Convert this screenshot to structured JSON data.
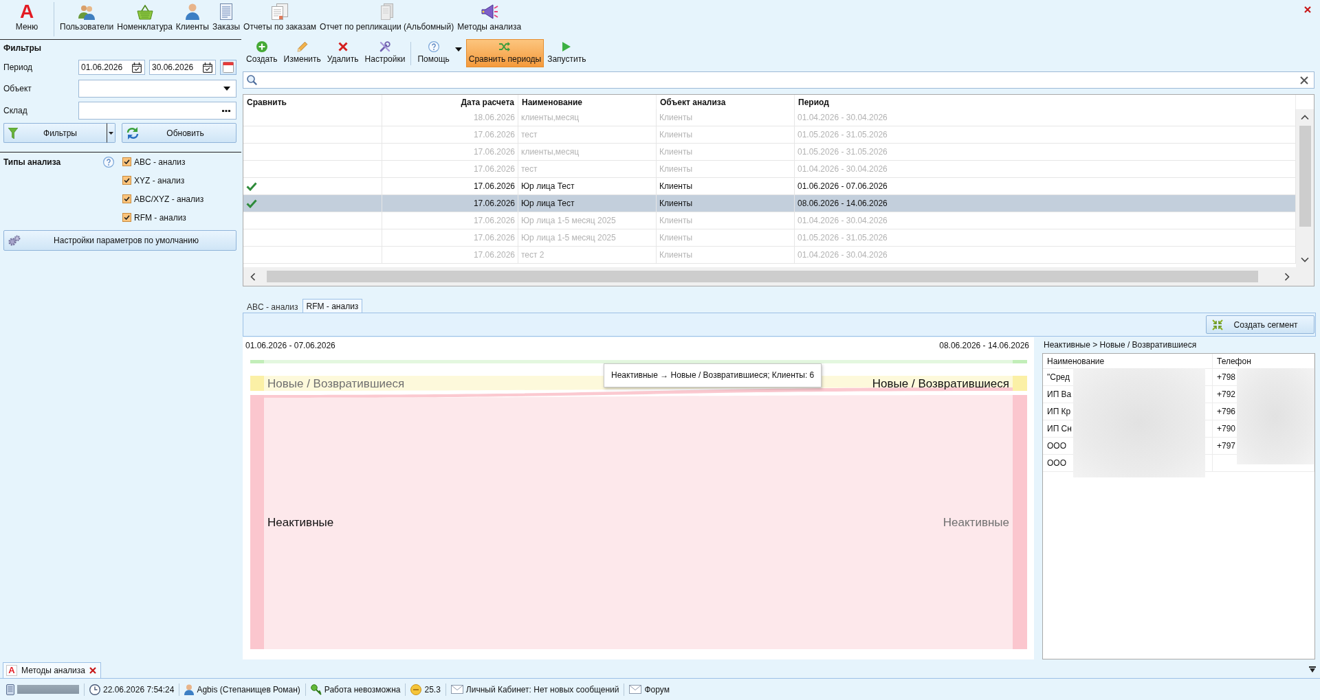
{
  "window": {
    "logo": "A",
    "menu_label": "Меню"
  },
  "ribbon": [
    {
      "label": "Пользователи"
    },
    {
      "label": "Номенклатура"
    },
    {
      "label": "Клиенты"
    },
    {
      "label": "Заказы"
    },
    {
      "label": "Отчеты по заказам"
    },
    {
      "label": "Отчет по репликации (Альбомный)"
    },
    {
      "label": "Методы анализа"
    }
  ],
  "filters": {
    "title": "Фильтры",
    "period_label": "Период",
    "date_from": "01.06.2026",
    "date_to": "30.06.2026",
    "object_label": "Объект",
    "warehouse_label": "Склад",
    "filters_button": "Фильтры",
    "refresh_button": "Обновить"
  },
  "analysis_types": {
    "title": "Типы анализа",
    "items": [
      {
        "label": "ABC - анализ",
        "checked": true
      },
      {
        "label": "XYZ - анализ",
        "checked": true
      },
      {
        "label": "ABC/XYZ - анализ",
        "checked": true
      },
      {
        "label": "RFM - анализ",
        "checked": true
      }
    ]
  },
  "defaults_button": "Настройки параметров по умолчанию",
  "toolbar": {
    "groups": [
      [
        {
          "label": "Создать",
          "kind": "button",
          "selected": false
        },
        {
          "label": "Изменить",
          "kind": "button",
          "selected": false
        },
        {
          "label": "Удалить",
          "kind": "button",
          "selected": false
        },
        {
          "label": "Настройки",
          "kind": "button",
          "selected": false
        }
      ],
      [
        {
          "label": "Помощь",
          "kind": "dropdown",
          "selected": false
        },
        {
          "label": "Сравнить периоды",
          "kind": "button",
          "selected": true
        },
        {
          "label": "Запустить",
          "kind": "button",
          "selected": false
        }
      ]
    ]
  },
  "table": {
    "columns": [
      "Сравнить",
      "Дата расчета",
      "Наименование",
      "Объект анализа",
      "Период"
    ],
    "rows": [
      {
        "compared": false,
        "selected": false,
        "disabled": true,
        "date": "18.06.2026",
        "name": "клиенты,месяц",
        "object": "Клиенты",
        "period": "01.04.2026 - 30.04.2026"
      },
      {
        "compared": false,
        "selected": false,
        "disabled": true,
        "date": "17.06.2026",
        "name": "тест",
        "object": "Клиенты",
        "period": "01.05.2026 - 31.05.2026"
      },
      {
        "compared": false,
        "selected": false,
        "disabled": true,
        "date": "17.06.2026",
        "name": "клиенты,месяц",
        "object": "Клиенты",
        "period": "01.05.2026 - 31.05.2026"
      },
      {
        "compared": false,
        "selected": false,
        "disabled": true,
        "date": "17.06.2026",
        "name": "тест",
        "object": "Клиенты",
        "period": "01.04.2026 - 30.04.2026"
      },
      {
        "compared": true,
        "selected": false,
        "disabled": false,
        "date": "17.06.2026",
        "name": "Юр лица Тест",
        "object": "Клиенты",
        "period": "01.06.2026 - 07.06.2026"
      },
      {
        "compared": true,
        "selected": true,
        "disabled": false,
        "date": "17.06.2026",
        "name": "Юр лица Тест",
        "object": "Клиенты",
        "period": "08.06.2026 - 14.06.2026"
      },
      {
        "compared": false,
        "selected": false,
        "disabled": true,
        "date": "17.06.2026",
        "name": "Юр лица 1-5 месяц 2025",
        "object": "Клиенты",
        "period": "01.04.2026 - 30.04.2026"
      },
      {
        "compared": false,
        "selected": false,
        "disabled": true,
        "date": "17.06.2026",
        "name": "Юр лица 1-5 месяц 2025",
        "object": "Клиенты",
        "period": "01.05.2026 - 31.05.2026"
      },
      {
        "compared": false,
        "selected": false,
        "disabled": true,
        "date": "17.06.2026",
        "name": "тест 2",
        "object": "Клиенты",
        "period": "01.04.2026 - 30.04.2026"
      }
    ]
  },
  "analysis_tabs": [
    {
      "label": "ABC - анализ",
      "selected": false
    },
    {
      "label": "RFM - анализ",
      "selected": true
    }
  ],
  "create_segment_button": "Создать сегмент",
  "sankey": {
    "left_period": "01.06.2026 - 07.06.2026",
    "right_period": "08.06.2026 - 14.06.2026",
    "left_nodes": [
      {
        "color": "#c2eeb8"
      },
      {
        "color": "#fbf0a6",
        "label": {
          "text": "Новые / Возвратившиеся",
          "highlighted": false
        }
      },
      {
        "color": "#fbc6ce",
        "label": {
          "text": "Неактивные",
          "highlighted": true
        }
      }
    ],
    "right_nodes": [
      {
        "color": "#c2eeb8"
      },
      {
        "color": "#fbf0a6",
        "label": {
          "text": "Новые / Возвратившиеся",
          "highlighted": true
        }
      },
      {
        "color": "#fbc6ce",
        "label": {
          "text": "Неактивные",
          "highlighted": false
        }
      }
    ],
    "tooltip": "Неактивные → Новые / Возвратившиеся; Клиенты: 6"
  },
  "segment": {
    "title": "Неактивные > Новые / Возвратившиеся",
    "columns": [
      "Наименование",
      "Телефон"
    ],
    "rows": [
      {
        "name": "\"Сред",
        "phone": "+798"
      },
      {
        "name": "ИП Ва",
        "phone": "+792"
      },
      {
        "name": "ИП Кр",
        "phone": "+796"
      },
      {
        "name": "ИП Сн",
        "phone": "+790"
      },
      {
        "name": "ООО",
        "phone": "+797"
      },
      {
        "name": "ООО"
      }
    ]
  },
  "document_tab": {
    "icon": "A",
    "label": "Методы анализа"
  },
  "status_bar": [
    "22.06.2026 7:54:24",
    "Agbis (Степанищев Роман)",
    "Работа невозможна",
    "25.3",
    "Личный Кабинет: Нет новых сообщений",
    "Форум"
  ]
}
